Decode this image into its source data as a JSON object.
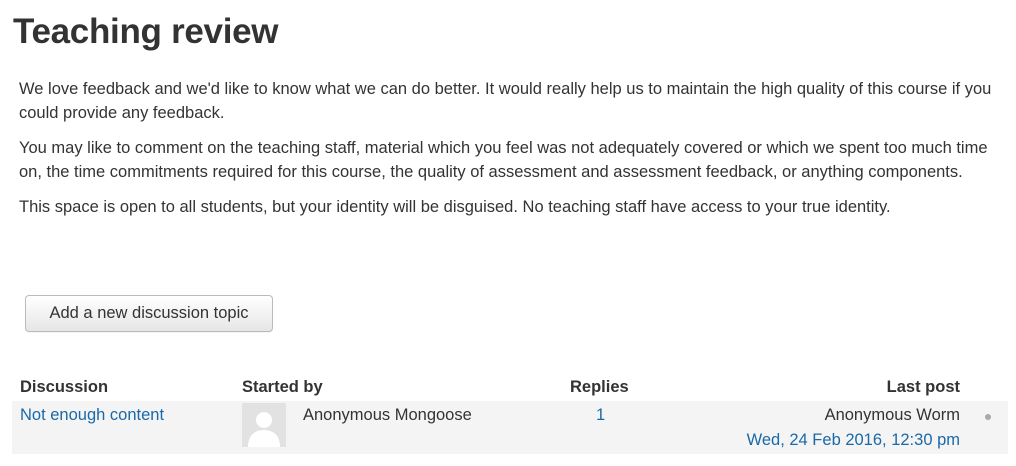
{
  "page": {
    "title": "Teaching review"
  },
  "intro": {
    "paragraphs": [
      "We love feedback and we'd like to know what we can do better. It would really help us to maintain the high quality of this course if you could provide any feedback.",
      "You may like to comment on the teaching staff, material which you feel was not adequately covered or which we spent too much time on, the time commitments required for this course, the quality of assessment and assessment feedback, or anything components.",
      "This space is open to all students, but your identity will be disguised. No teaching staff have access to your true identity."
    ]
  },
  "actions": {
    "add_topic_label": "Add a new discussion topic"
  },
  "table": {
    "headers": {
      "discussion": "Discussion",
      "started_by": "Started by",
      "replies": "Replies",
      "last_post": "Last post"
    },
    "rows": [
      {
        "discussion": "Not enough content",
        "started_by": "Anonymous Mongoose",
        "replies": "1",
        "last_post_author": "Anonymous Worm",
        "last_post_date": "Wed, 24 Feb 2016, 12:30 pm"
      }
    ]
  },
  "icons": {
    "avatar": "user-avatar-icon",
    "menu": "dot-icon"
  },
  "colors": {
    "link": "#1a69a8",
    "row_background": "#f4f4f4",
    "text": "#333333"
  }
}
